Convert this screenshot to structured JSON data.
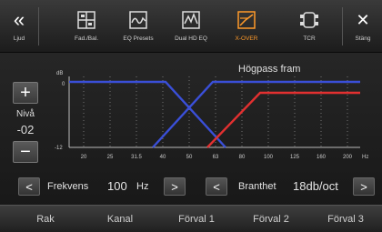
{
  "topbar": {
    "back_glyph": "«",
    "back_label": "Ljud",
    "fad_label": "Fad./Bal.",
    "eq_presets_label": "EQ Presets",
    "dual_hd_eq_label": "Dual HD EQ",
    "xover_label": "X-OVER",
    "tcr_label": "TCR",
    "close_glyph": "✕",
    "close_label": "Stäng",
    "active_color": "#ff9a2a"
  },
  "level": {
    "plus": "+",
    "minus": "−",
    "label": "Nivå",
    "value": "-02"
  },
  "graph": {
    "title": "Högpass fram",
    "db_unit": "dB",
    "y_top_label": "0",
    "y_bottom_label": "-12",
    "freq_labels": [
      "20",
      "25",
      "31.5",
      "40",
      "50",
      "63",
      "80",
      "100",
      "125",
      "160",
      "200"
    ],
    "hz_label": "Hz",
    "colors": {
      "series_blue": "#3a4fd8",
      "series_red": "#e23030",
      "grid": "#8a8a8a"
    }
  },
  "controls": {
    "freq_label": "Frekvens",
    "freq_value": "100",
    "freq_unit": "Hz",
    "slope_label": "Branthet",
    "slope_value": "18db/oct",
    "left_arrow": "<",
    "right_arrow": ">"
  },
  "presets": [
    "Rak",
    "Kanal",
    "Förval 1",
    "Förval 2",
    "Förval 3"
  ]
}
